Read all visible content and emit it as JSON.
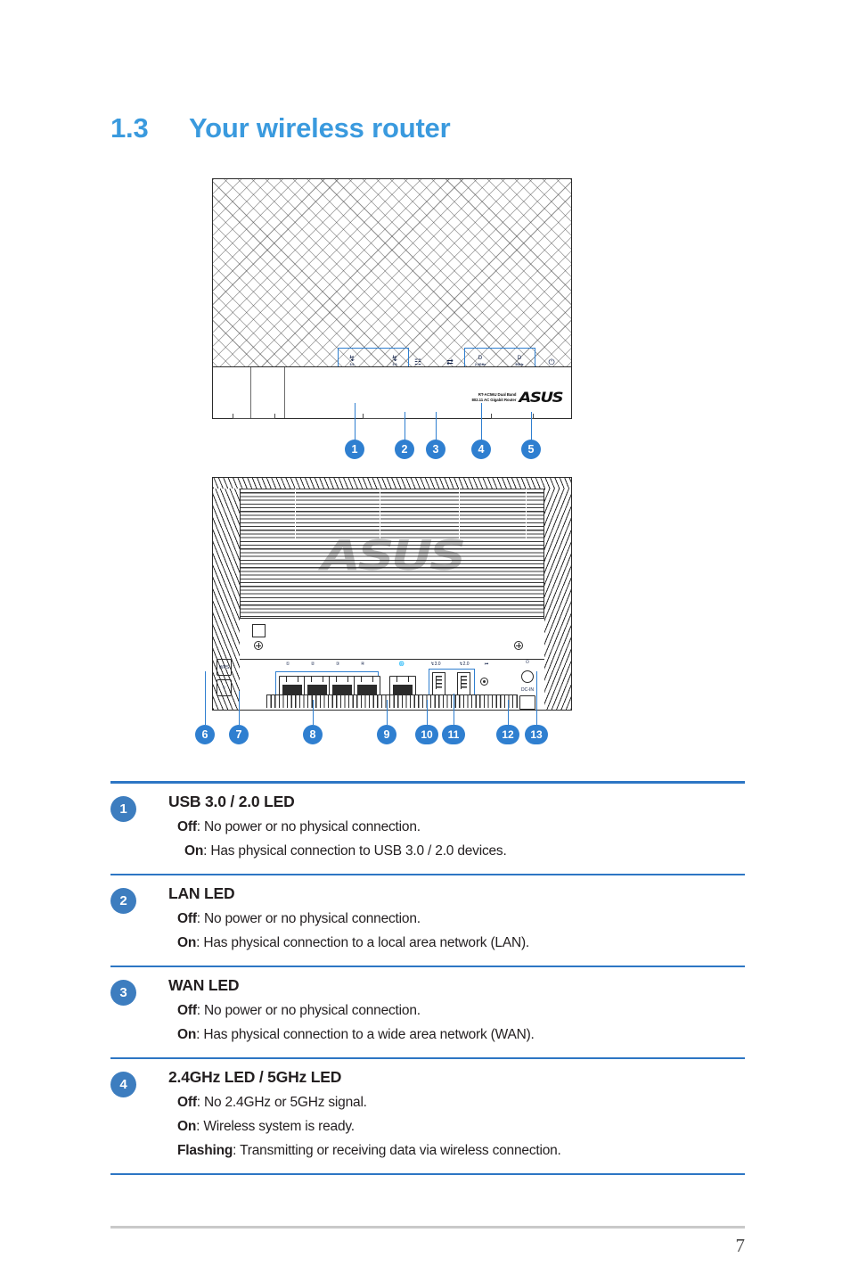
{
  "document": {
    "section_number": "1.3",
    "section_title": "Your wireless router",
    "page_number": "7"
  },
  "figure_top_view": {
    "name": "router-top-view",
    "brand_model_line1": "RT-AC56U Dual Band",
    "brand_model_line2": "802.11 AC Gigabit Router",
    "brand_logo": "ASUS",
    "led_indicators": [
      {
        "icon": "usb-3-icon",
        "label": "3.0"
      },
      {
        "icon": "usb-2-icon",
        "label": "2.0"
      },
      {
        "icon": "lan-icon",
        "label": ""
      },
      {
        "icon": "wan-icon",
        "label": ""
      },
      {
        "icon": "wifi-icon",
        "label": "2.4GHz"
      },
      {
        "icon": "wifi-icon",
        "label": "5GHz"
      },
      {
        "icon": "power-icon",
        "label": ""
      }
    ],
    "callouts": [
      "1",
      "2",
      "3",
      "4",
      "5"
    ]
  },
  "figure_rear_view": {
    "name": "router-rear-view",
    "vent_logo": "ASUS",
    "port_labels": [
      "1",
      "2",
      "3",
      "4",
      "WAN",
      "USB 3.0",
      "USB 2.0",
      "RESET"
    ],
    "buttons": [
      "WPS",
      "WiFi"
    ],
    "callouts": [
      "6",
      "7",
      "8",
      "9",
      "10",
      "11",
      "12",
      "13"
    ]
  },
  "descriptions": [
    {
      "number": "1",
      "title": "USB 3.0 / 2.0 LED",
      "states": [
        {
          "key": "Off",
          "text": ": No power or no physical connection."
        },
        {
          "key": "On",
          "text": ": Has physical connection to USB 3.0 / 2.0 devices."
        }
      ]
    },
    {
      "number": "2",
      "title": "LAN LED",
      "states": [
        {
          "key": "Off",
          "text": ": No power or no physical connection."
        },
        {
          "key": "On",
          "text": ": Has physical connection to a local area network (LAN)."
        }
      ]
    },
    {
      "number": "3",
      "title": "WAN LED",
      "states": [
        {
          "key": "Off",
          "text": ": No power or no physical connection."
        },
        {
          "key": "On",
          "text": ": Has physical connection to a wide area network (WAN)."
        }
      ]
    },
    {
      "number": "4",
      "title": "2.4GHz LED / 5GHz LED",
      "states": [
        {
          "key": "Off",
          "text": ": No 2.4GHz or 5GHz signal."
        },
        {
          "key": "On",
          "text": ": Wireless system is ready."
        },
        {
          "key": "Flashing",
          "text": ": Transmitting or receiving data via wireless connection."
        }
      ]
    }
  ],
  "colors": {
    "title_blue": "#3a9ade",
    "rule_blue": "#2d76c4",
    "badge_blue": "#3d7dbf",
    "callout_blue": "#2f7fd0",
    "footer_gray": "#c9c9c9"
  }
}
